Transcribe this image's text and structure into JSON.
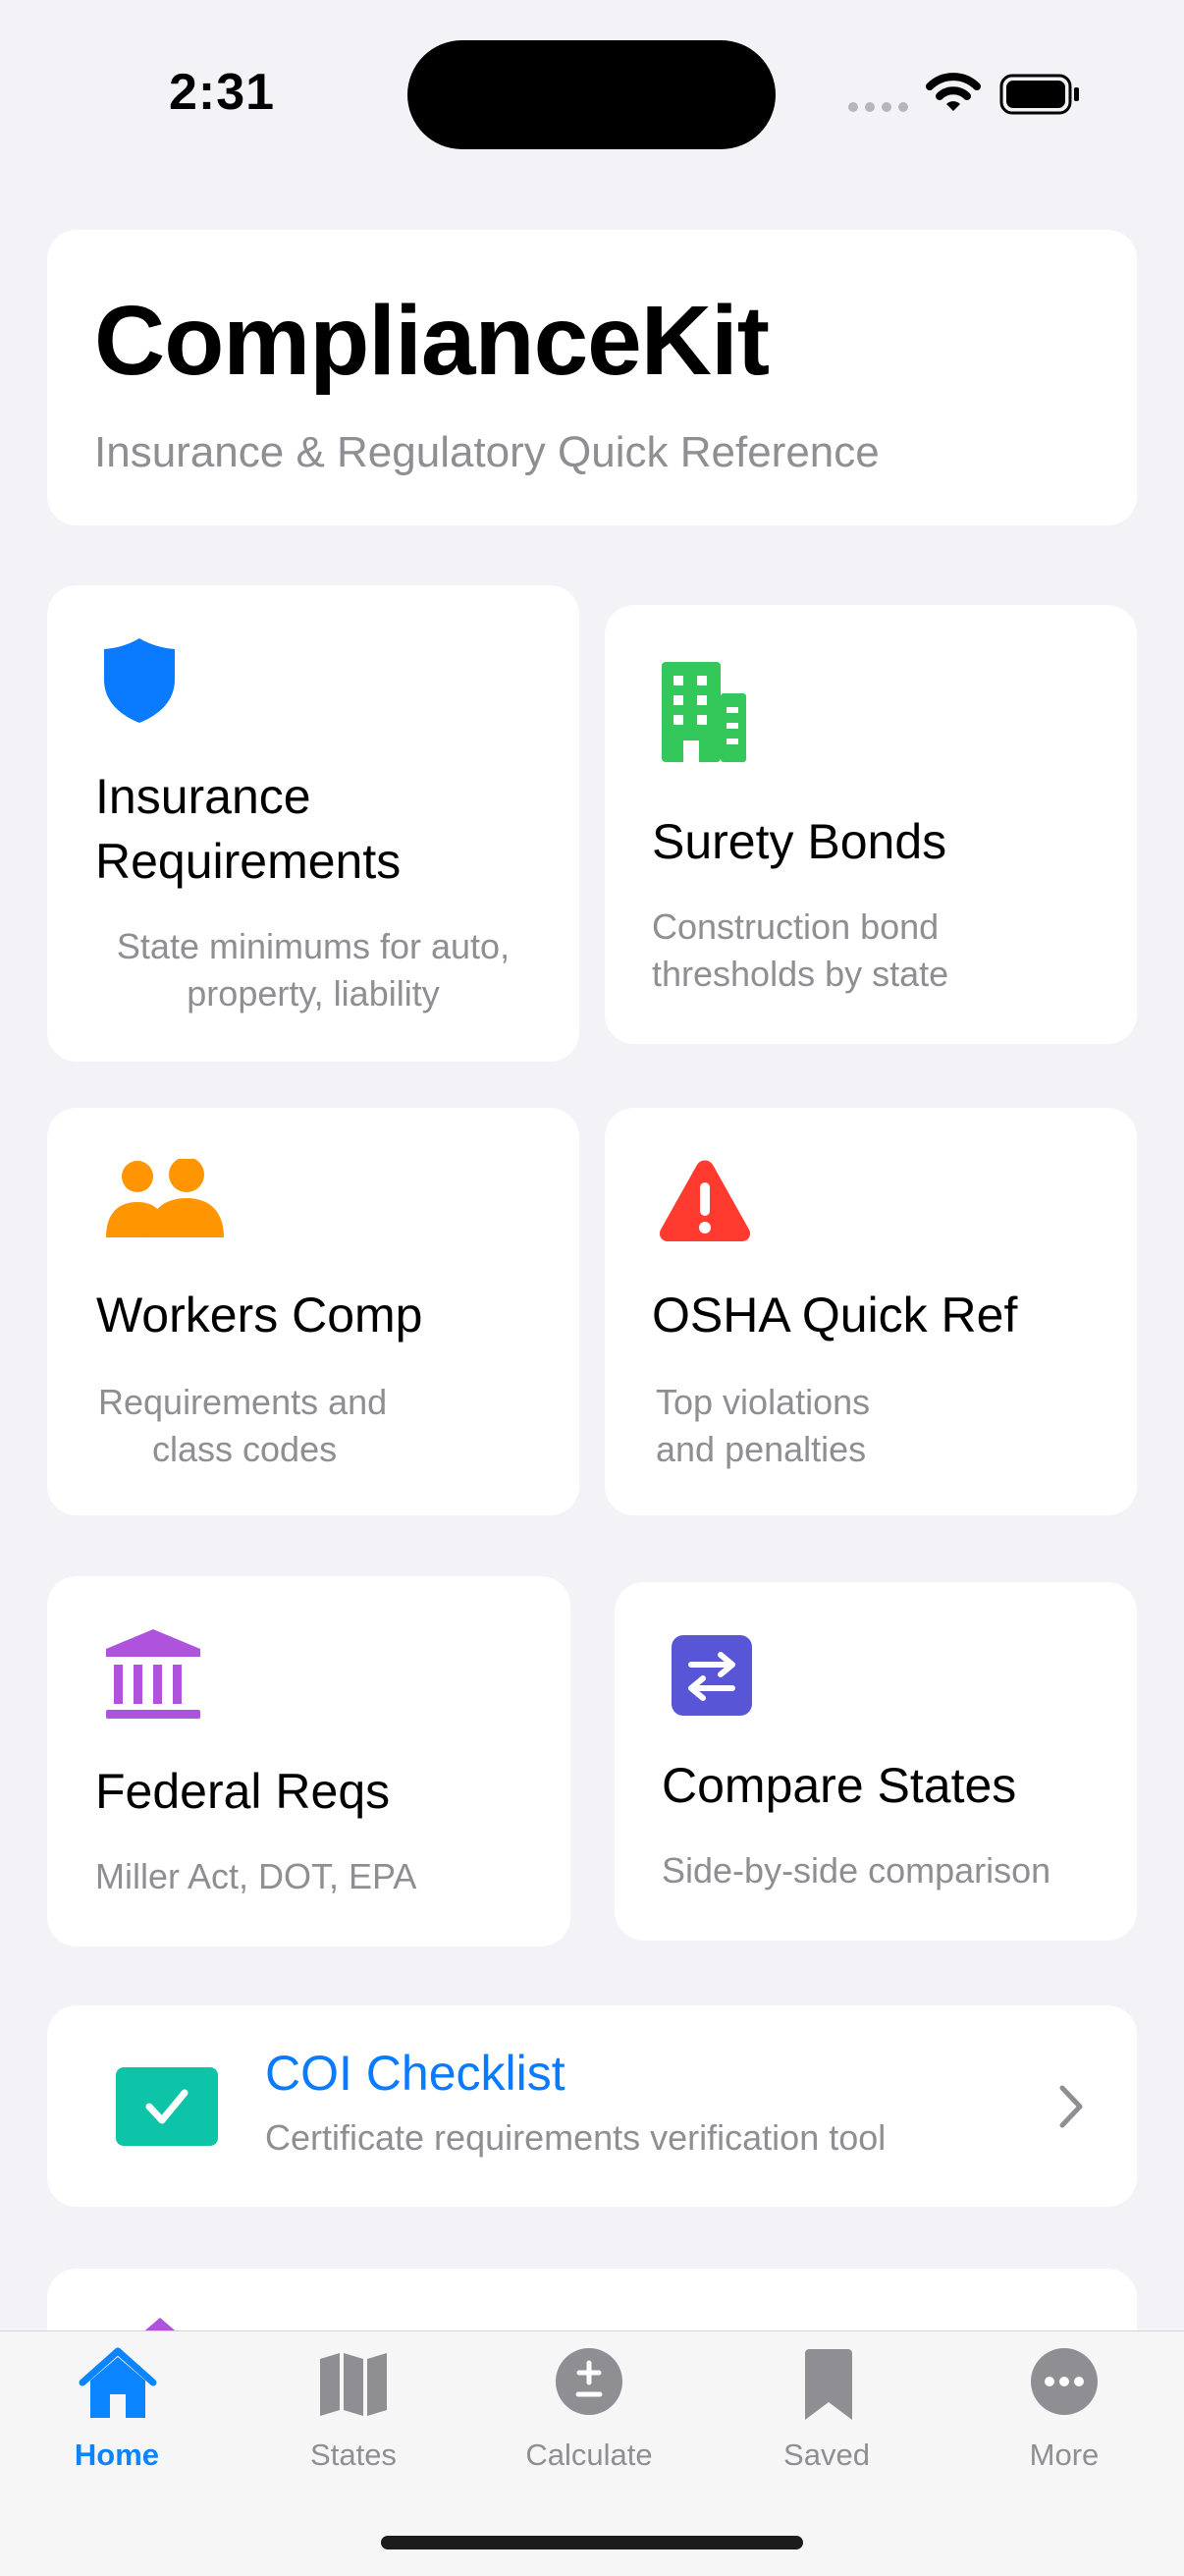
{
  "status_bar": {
    "time": "2:31"
  },
  "header": {
    "title": "ComplianceKit",
    "subtitle": "Insurance & Regulatory Quick Reference"
  },
  "cards": {
    "insurance": {
      "title_line1": "Insurance",
      "title_line2": "Requirements",
      "desc_line1": "State minimums for auto,",
      "desc_line2": "property, liability",
      "icon": "shield-icon",
      "color": "#0a7aff"
    },
    "surety": {
      "title": "Surety Bonds",
      "desc_line1": "Construction bond",
      "desc_line2": "thresholds by state",
      "icon": "building-icon",
      "color": "#34c759"
    },
    "workers": {
      "title": "Workers Comp",
      "desc_line1": "Requirements and",
      "desc_line2": "class codes",
      "icon": "people-icon",
      "color": "#ff9500"
    },
    "osha": {
      "title": "OSHA Quick Ref",
      "desc_line1": "Top violations",
      "desc_line2": "and penalties",
      "icon": "warning-icon",
      "color": "#ff3b30"
    },
    "federal": {
      "title": "Federal Reqs",
      "desc": "Miller Act, DOT, EPA",
      "icon": "bank-icon",
      "color": "#af52de"
    },
    "compare": {
      "title": "Compare States",
      "desc": "Side-by-side comparison",
      "icon": "arrows-icon",
      "color": "#5856d6"
    }
  },
  "coi": {
    "title": "COI Checklist",
    "desc": "Certificate requirements verification tool",
    "accent": "#0a7aff",
    "icon_color": "#0dc4a8"
  },
  "tabbar": {
    "tabs": [
      {
        "label": "Home",
        "icon": "house-icon",
        "active": true
      },
      {
        "label": "States",
        "icon": "map-icon",
        "active": false
      },
      {
        "label": "Calculate",
        "icon": "plus-minus-icon",
        "active": false
      },
      {
        "label": "Saved",
        "icon": "bookmark-icon",
        "active": false
      },
      {
        "label": "More",
        "icon": "ellipsis-icon",
        "active": false
      }
    ]
  }
}
